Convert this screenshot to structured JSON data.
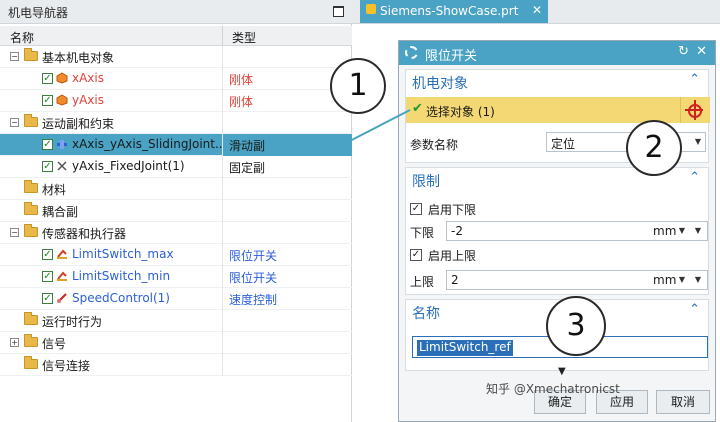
{
  "navigator": {
    "title": "机电导航器",
    "col_name": "名称",
    "col_type": "类型",
    "rows": [
      {
        "label": "基本机电对象",
        "type": ""
      },
      {
        "label": "xAxis",
        "type": "刚体"
      },
      {
        "label": "yAxis",
        "type": "刚体"
      },
      {
        "label": "运动副和约束",
        "type": ""
      },
      {
        "label": "xAxis_yAxis_SlidingJoint...",
        "type": "滑动副"
      },
      {
        "label": "yAxis_FixedJoint(1)",
        "type": "固定副"
      },
      {
        "label": "材料",
        "type": ""
      },
      {
        "label": "耦合副",
        "type": ""
      },
      {
        "label": "传感器和执行器",
        "type": ""
      },
      {
        "label": "LimitSwitch_max",
        "type": "限位开关"
      },
      {
        "label": "LimitSwitch_min",
        "type": "限位开关"
      },
      {
        "label": "SpeedControl(1)",
        "type": "速度控制"
      },
      {
        "label": "运行时行为",
        "type": ""
      },
      {
        "label": "信号",
        "type": ""
      },
      {
        "label": "信号连接",
        "type": ""
      }
    ]
  },
  "tab": {
    "label": "Siemens-ShowCase.prt"
  },
  "dialog": {
    "title": "限位开关",
    "section_object": "机电对象",
    "select_object": "选择对象 (1)",
    "param_name_label": "参数名称",
    "param_name_value": "定位",
    "section_limit": "限制",
    "enable_lower": "启用下限",
    "lower_label": "下限",
    "lower_value": "-2",
    "lower_unit": "mm",
    "enable_upper": "启用上限",
    "upper_label": "上限",
    "upper_value": "2",
    "upper_unit": "mm",
    "section_name": "名称",
    "name_value": "LimitSwitch_ref",
    "ok": "确定",
    "apply": "应用",
    "cancel": "取消"
  },
  "callouts": [
    "1",
    "2",
    "3"
  ],
  "watermark": "知乎 @Xmechatronicst"
}
